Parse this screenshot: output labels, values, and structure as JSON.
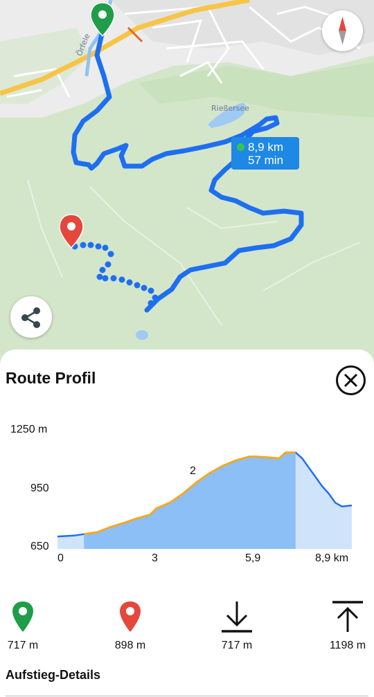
{
  "map": {
    "street_label": "Örfele",
    "lake_label": "Rießersee",
    "route_distance": "8,9 km",
    "route_time": "57 min",
    "colors": {
      "route": "#1e6ff0",
      "start_pin": "#1f9d48",
      "end_pin": "#e5473c",
      "badge": "#1e88e5"
    },
    "icons": [
      "start-pin-icon",
      "end-pin-icon",
      "compass-icon",
      "share-icon"
    ]
  },
  "sheet": {
    "title": "Route Profil",
    "close_icon": "close-circle-icon",
    "chart_data": {
      "type": "area",
      "title": "",
      "xlabel": "",
      "ylabel": "",
      "y_ticks": [
        "1250 m",
        "950",
        "650"
      ],
      "x_ticks": [
        "0",
        "3",
        "5,9",
        "8,9 km"
      ],
      "ylim": [
        650,
        1250
      ],
      "xlim": [
        0,
        8.9
      ],
      "marker_label": "2",
      "highlight_range_km": [
        0.8,
        8.9
      ],
      "x": [
        0,
        0.5,
        0.8,
        1.2,
        1.6,
        2.0,
        2.4,
        2.8,
        3.0,
        3.4,
        3.8,
        4.2,
        4.6,
        5.0,
        5.4,
        5.8,
        6.0,
        6.4,
        6.7,
        6.9,
        7.2,
        7.4,
        7.6,
        7.8,
        8.0,
        8.2,
        8.4,
        8.6,
        8.9
      ],
      "y": [
        717,
        722,
        730,
        740,
        768,
        790,
        815,
        835,
        870,
        900,
        950,
        1010,
        1060,
        1100,
        1130,
        1150,
        1150,
        1145,
        1140,
        1172,
        1172,
        1140,
        1090,
        1040,
        990,
        950,
        900,
        880,
        885
      ],
      "colors": {
        "fill": "#8cbff6",
        "fill_light": "#cfe4fb",
        "line": "#1e6ff0",
        "segment": "#f4a823"
      }
    },
    "stats": [
      {
        "icon": "green-pin-icon",
        "value": "717 m"
      },
      {
        "icon": "red-pin-icon",
        "value": "898 m"
      },
      {
        "icon": "arrow-down-icon",
        "value": "717 m"
      },
      {
        "icon": "arrow-up-bar-icon",
        "value": "1198 m"
      }
    ],
    "section_title": "Aufstieg-Details"
  }
}
